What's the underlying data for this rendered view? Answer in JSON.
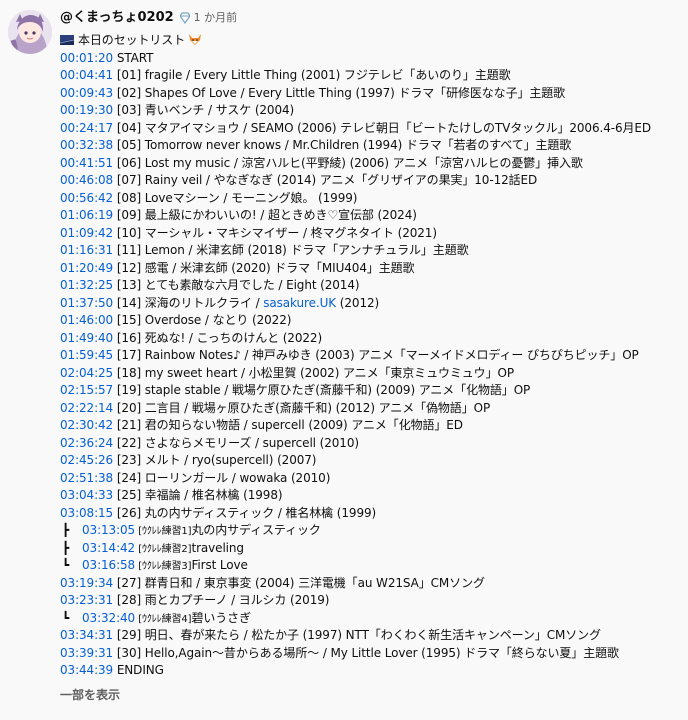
{
  "author": {
    "name": "@くまっちょ0202",
    "time_ago": "1 か月前"
  },
  "title": "本日のセットリスト",
  "setlist": [
    {
      "time": "00:01:20",
      "text": " START"
    },
    {
      "time": "00:04:41",
      "text": " [01] fragile / Every Little Thing (2001) フジテレビ「あいのり」主題歌"
    },
    {
      "time": "00:09:43",
      "text": " [02] Shapes Of Love / Every Little Thing (1997) ドラマ「研修医なな子」主題歌"
    },
    {
      "time": "00:19:30",
      "text": " [03] 青いベンチ / サスケ (2004)"
    },
    {
      "time": "00:24:17",
      "text": " [04] マタアイマショウ / SEAMO (2006) テレビ朝日「ビートたけしのTVタックル」2006.4-6月ED"
    },
    {
      "time": "00:32:38",
      "text": " [05] Tomorrow never knows / Mr.Children (1994) ドラマ「若者のすべて」主題歌"
    },
    {
      "time": "00:41:51",
      "text": " [06] Lost my music / 涼宮ハルヒ(平野綾) (2006) アニメ「涼宮ハルヒの憂鬱」挿入歌"
    },
    {
      "time": "00:46:08",
      "text": " [07] Rainy veil / やなぎなぎ (2014) アニメ「グリザイアの果実」10-12話ED"
    },
    {
      "time": "00:56:42",
      "text": " [08] Loveマシーン / モーニング娘。 (1999)"
    },
    {
      "time": "01:06:19",
      "text": " [09] 最上級にかわいいの! / 超ときめき♡宣伝部 (2024)"
    },
    {
      "time": "01:09:42",
      "text": " [10] マーシャル・マキシマイザー / 柊マグネタイト (2021)"
    },
    {
      "time": "01:16:31",
      "text": " [11] Lemon / 米津玄師 (2018) ドラマ「アンナチュラル」主題歌"
    },
    {
      "time": "01:20:49",
      "text": " [12] 感電 / 米津玄師 (2020) ドラマ「MIU404」主題歌"
    },
    {
      "time": "01:32:25",
      "text": " [13] とても素敵な六月でした / Eight (2014)"
    },
    {
      "time": "01:37:50",
      "text": " [14] 深海のリトルクライ / ",
      "link": "sasakure.UK",
      "after": " (2012)"
    },
    {
      "time": "01:46:00",
      "text": " [15] Overdose / なとり (2022)"
    },
    {
      "time": "01:49:40",
      "text": " [16] 死ぬな! / こっちのけんと (2022)"
    },
    {
      "time": "01:59:45",
      "text": " [17] Rainbow Notes♪ / 神戸みゆき (2003) アニメ「マーメイドメロディー ぴちぴちピッチ」OP"
    },
    {
      "time": "02:04:25",
      "text": " [18] my sweet heart / 小松里賀 (2002) アニメ「東京ミュウミュウ」OP"
    },
    {
      "time": "02:15:57",
      "text": " [19] staple stable / 戦場ケ原ひたぎ(斎藤千和) (2009) アニメ「化物語」OP"
    },
    {
      "time": "02:22:14",
      "text": " [20] 二言目 / 戦場ヶ原ひたぎ(斎藤千和) (2012) アニメ「偽物語」OP"
    },
    {
      "time": "02:30:42",
      "text": " [21] 君の知らない物語 / supercell (2009) アニメ「化物語」ED"
    },
    {
      "time": "02:36:24",
      "text": " [22] さよならメモリーズ / supercell (2010)"
    },
    {
      "time": "02:45:26",
      "text": " [23] メルト / ryo(supercell) (2007)"
    },
    {
      "time": "02:51:38",
      "text": " [24] ローリンガール / wowaka (2010)"
    },
    {
      "time": "03:04:33",
      "text": " [25] 幸福論 / 椎名林檎 (1998)"
    },
    {
      "time": "03:08:15",
      "text": " [26] 丸の内サディスティック / 椎名林檎 (1999)"
    },
    {
      "sub": true,
      "tree": "┣",
      "time": "03:13:05",
      "tag": " [ｳｸﾚﾚ練習1]",
      "text": "丸の内サディスティック"
    },
    {
      "sub": true,
      "tree": "┣",
      "time": "03:14:42",
      "tag": " [ｳｸﾚﾚ練習2]",
      "text": "traveling"
    },
    {
      "sub": true,
      "tree": "┗",
      "time": "03:16:58",
      "tag": " [ｳｸﾚﾚ練習3]",
      "text": "First Love"
    },
    {
      "time": "03:19:34",
      "text": " [27] 群青日和 / 東京事変 (2004) 三洋電機「au W21SA」CMソング"
    },
    {
      "time": "03:23:31",
      "text": " [28] 雨とカプチーノ / ヨルシカ (2019)"
    },
    {
      "sub": true,
      "tree": "┗",
      "time": "03:32:40",
      "tag": " [ｳｸﾚﾚ練習4]",
      "text": "碧いうさぎ"
    },
    {
      "time": "03:34:31",
      "text": " [29] 明日、春が来たら / 松たか子 (1997) NTT「わくわく新生活キャンペーン」CMソング"
    },
    {
      "time": "03:39:31",
      "text": " [30] Hello,Again～昔からある場所～ / My Little Lover (1995) ドラマ「終らない夏」主題歌"
    },
    {
      "time": "03:44:39",
      "text": " ENDING"
    }
  ],
  "show_more": "一部を表示",
  "icons": {
    "avatar": "avatar-image",
    "gem": "gem-icon",
    "flag": "flag-icon",
    "fox": "fox-icon"
  },
  "colors": {
    "link": "#065fd4",
    "text": "#0f0f0f",
    "secondary": "#606060",
    "background": "#f9f9f9"
  }
}
